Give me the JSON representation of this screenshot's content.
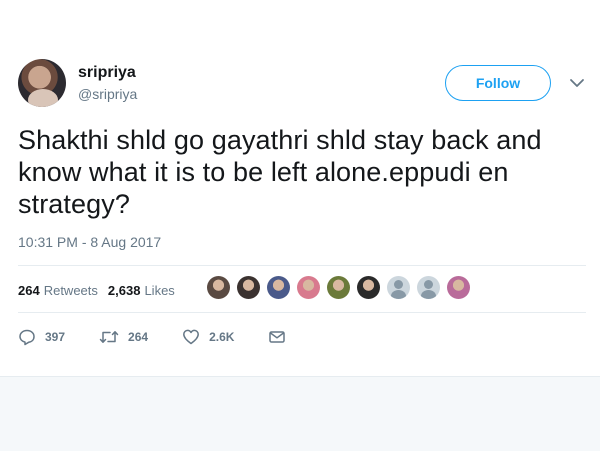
{
  "tweet": {
    "author_name": "sripriya",
    "author_handle": "@sripriya",
    "follow_label": "Follow",
    "text": "Shakthi shld go gayathri shld stay back and know what it is to be left alone.eppudi en strategy?",
    "timestamp": "10:31 PM - 8 Aug 2017"
  },
  "stats": {
    "retweets_count": "264",
    "retweets_label": "Retweets",
    "likes_count": "2,638",
    "likes_label": "Likes"
  },
  "likers": [
    {
      "icon": "user-avatar",
      "color": "#5a4a42"
    },
    {
      "icon": "user-avatar",
      "color": "#3b3230"
    },
    {
      "icon": "user-avatar",
      "color": "#4a5a8a"
    },
    {
      "icon": "user-avatar",
      "color": "#d87a8e"
    },
    {
      "icon": "user-avatar",
      "color": "#6b7a3a"
    },
    {
      "icon": "user-avatar",
      "color": "#2a2a2a"
    },
    {
      "icon": "default-avatar-icon",
      "color": "#ccd6dd"
    },
    {
      "icon": "default-avatar-icon",
      "color": "#ccd6dd"
    },
    {
      "icon": "user-avatar",
      "color": "#b96b9a"
    }
  ],
  "actions": {
    "reply_count": "397",
    "retweet_count": "264",
    "like_count": "2.6K"
  },
  "colors": {
    "accent": "#1da1f2",
    "secondary_text": "#657786",
    "divider": "#e6ecf0"
  }
}
